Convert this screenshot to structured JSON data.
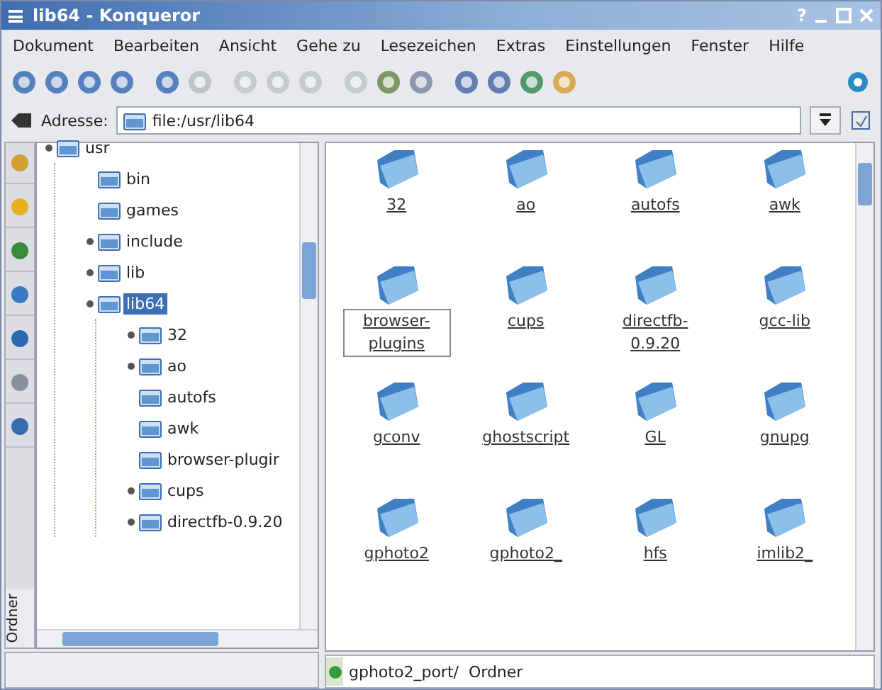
{
  "window": {
    "title": "lib64 - Konqueror",
    "help_button": "?"
  },
  "menu": [
    "Dokument",
    "Bearbeiten",
    "Ansicht",
    "Gehe zu",
    "Lesezeichen",
    "Extras",
    "Einstellungen",
    "Fenster",
    "Hilfe"
  ],
  "address": {
    "label": "Adresse:",
    "value": "file:/usr/lib64"
  },
  "sidebar": {
    "tab_label": "Ordner"
  },
  "tree": [
    {
      "label": "usr",
      "expandable": true,
      "selected": false,
      "children": [
        {
          "label": "bin",
          "expandable": false,
          "selected": false
        },
        {
          "label": "games",
          "expandable": false,
          "selected": false
        },
        {
          "label": "include",
          "expandable": true,
          "selected": false
        },
        {
          "label": "lib",
          "expandable": true,
          "selected": false
        },
        {
          "label": "lib64",
          "expandable": true,
          "selected": true,
          "children": [
            {
              "label": "32",
              "expandable": true,
              "selected": false
            },
            {
              "label": "ao",
              "expandable": true,
              "selected": false
            },
            {
              "label": "autofs",
              "expandable": false,
              "selected": false
            },
            {
              "label": "awk",
              "expandable": false,
              "selected": false
            },
            {
              "label": "browser-plugir",
              "expandable": false,
              "selected": false
            },
            {
              "label": "cups",
              "expandable": true,
              "selected": false
            },
            {
              "label": "directfb-0.9.20",
              "expandable": true,
              "selected": false
            }
          ]
        }
      ]
    }
  ],
  "files": [
    {
      "name": "32",
      "focused": false
    },
    {
      "name": "ao",
      "focused": false
    },
    {
      "name": "autofs",
      "focused": false
    },
    {
      "name": "awk",
      "focused": false
    },
    {
      "name": "browser-plugins",
      "focused": true
    },
    {
      "name": "cups",
      "focused": false
    },
    {
      "name": "directfb-0.9.20",
      "focused": false
    },
    {
      "name": "gcc-lib",
      "focused": false
    },
    {
      "name": "gconv",
      "focused": false
    },
    {
      "name": "ghostscript",
      "focused": false
    },
    {
      "name": "GL",
      "focused": false
    },
    {
      "name": "gnupg",
      "focused": false
    },
    {
      "name": "gphoto2",
      "focused": false
    },
    {
      "name": "gphoto2_",
      "focused": false
    },
    {
      "name": "hfs",
      "focused": false
    },
    {
      "name": "imlib2_",
      "focused": false
    }
  ],
  "status_bar": {
    "text": "gphoto2_port/  Ordner"
  }
}
